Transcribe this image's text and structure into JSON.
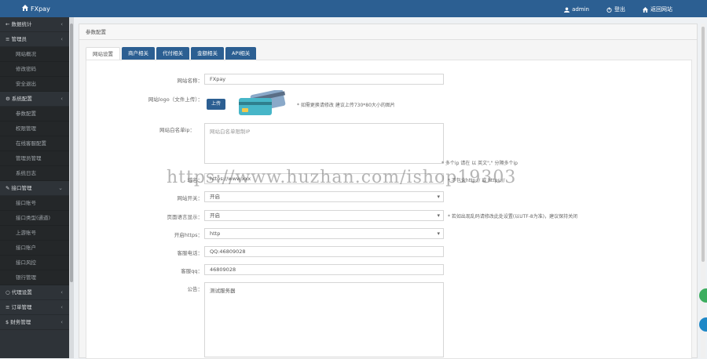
{
  "header": {
    "brand": "FXpay",
    "user": "admin",
    "logout": "登出",
    "home": "返回网站"
  },
  "sidebar": {
    "items": [
      {
        "label": "数据统计",
        "icon": "arrow-left-icon",
        "type": "group"
      },
      {
        "label": "管理员",
        "icon": "menu-icon",
        "type": "group"
      },
      {
        "label": "网站概况",
        "type": "sub"
      },
      {
        "label": "修改密码",
        "type": "sub"
      },
      {
        "label": "安全退出",
        "type": "sub"
      },
      {
        "label": "系统配置",
        "icon": "gear-icon",
        "type": "group"
      },
      {
        "label": "参数配置",
        "type": "sub"
      },
      {
        "label": "权限管理",
        "type": "sub"
      },
      {
        "label": "在线客服配置",
        "type": "sub"
      },
      {
        "label": "管理员管理",
        "type": "sub"
      },
      {
        "label": "系统日志",
        "type": "sub"
      },
      {
        "label": "接口管理",
        "icon": "wrench-icon",
        "type": "group"
      },
      {
        "label": "接口账号",
        "type": "sub"
      },
      {
        "label": "接口类型(通道)",
        "type": "sub"
      },
      {
        "label": "上游账号",
        "type": "sub"
      },
      {
        "label": "接口账户",
        "type": "sub"
      },
      {
        "label": "接口风控",
        "type": "sub"
      },
      {
        "label": "银行管理",
        "type": "sub"
      },
      {
        "label": "代理设置",
        "icon": "circle-icon",
        "type": "group"
      },
      {
        "label": "订单管理",
        "icon": "menu-icon",
        "type": "group"
      },
      {
        "label": "财务管理",
        "icon": "dollar-icon",
        "type": "group"
      }
    ]
  },
  "panel": {
    "title": "参数配置",
    "tabs": [
      "网站设置",
      "商户相关",
      "代付相关",
      "金额相关",
      "API相关"
    ]
  },
  "form": {
    "site_name_label": "网站名称：",
    "site_name_value": "FXpay",
    "logo_label": "网站logo（文件上传）：",
    "upload_label": "上传",
    "logo_hint": "* 如需更换请修改 建议上传730*80大小的图片",
    "ip_label": "网站白名单ip：",
    "ip_placeholder": "网站白名单限制IP",
    "ip_hint": "* 多个ip 请在 以 英文\",\" 分隔多个ip",
    "addr_label": "域名：",
    "addr_value": "https://www.xxx",
    "addr_hint": "* 不包含http:// 或 https://",
    "switch_label": "网站开关：",
    "switch_value": "开启",
    "pagecheck_label": "页面语言显示：",
    "pagecheck_value": "开启",
    "pagecheck_hint": "* 若如出现乱码请修改此处设置(以UTF-8为准)，建议保持关闭",
    "https_label": "开启https：",
    "https_value": "http",
    "phone_label": "客服电话：",
    "phone_value": "QQ:46809028",
    "qq_label": "客服qq：",
    "qq_value": "46809028",
    "notice_label": "公告：",
    "notice_value": "测试服务器"
  },
  "watermark": "https://www.huzhan.com/ishop19303"
}
